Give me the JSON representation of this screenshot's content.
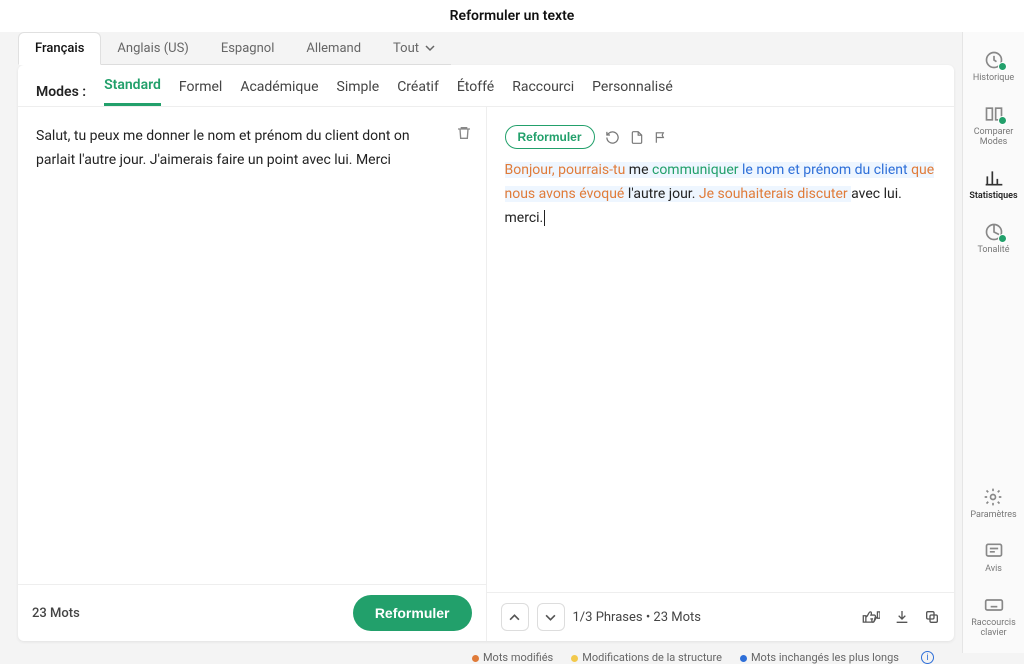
{
  "header": {
    "title": "Reformuler un texte"
  },
  "langs": {
    "items": [
      "Français",
      "Anglais (US)",
      "Espagnol",
      "Allemand",
      "Tout"
    ],
    "active": 0
  },
  "modes": {
    "label": "Modes :",
    "items": [
      "Standard",
      "Formel",
      "Académique",
      "Simple",
      "Créatif",
      "Étoffé",
      "Raccourci",
      "Personnalisé"
    ],
    "active": 0
  },
  "input": {
    "text": "Salut, tu peux me donner le nom et prénom du client dont on parlait l'autre jour. J'aimerais faire un point avec lui. Merci",
    "word_count_label": "23 Mots",
    "reformuler_button": "Reformuler"
  },
  "output": {
    "toolbar": {
      "reformuler_pill": "Reformuler"
    },
    "segments": [
      {
        "t": "Bonjour, pourrais-tu ",
        "c": "orange",
        "hl": true
      },
      {
        "t": "me ",
        "c": "black",
        "hl": true
      },
      {
        "t": "communiquer ",
        "c": "green",
        "hl": true
      },
      {
        "t": "le nom et prénom du client ",
        "c": "blue",
        "hl": true
      },
      {
        "t": "que nous avons évoqué ",
        "c": "orange",
        "hl": true
      },
      {
        "t": "l'autre jour. ",
        "c": "black",
        "hl": true
      },
      {
        "t": "Je souhaiterais discuter ",
        "c": "orange",
        "hl": true
      },
      {
        "t": "avec lui. merci.",
        "c": "black"
      }
    ],
    "footer_status": "1/3 Phrases  •  23 Mots"
  },
  "legend": {
    "modified": "Mots modifiés",
    "structure": "Modifications de la structure",
    "unchanged": "Mots inchangés les plus longs"
  },
  "sidebar": {
    "history": "Historique",
    "compare": "Comparer Modes",
    "stats": "Statistiques",
    "tone": "Tonalité",
    "settings": "Paramètres",
    "reviews": "Avis",
    "shortcuts": "Raccourcis clavier"
  }
}
